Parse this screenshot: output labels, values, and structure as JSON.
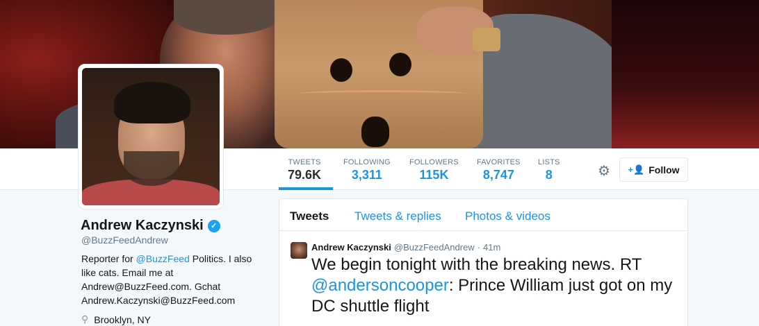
{
  "profile": {
    "name": "Andrew Kaczynski",
    "handle": "@BuzzFeedAndrew",
    "bio_prefix": "Reporter for ",
    "bio_link": "@BuzzFeed",
    "bio_suffix": " Politics. I also like cats. Email me at Andrew@BuzzFeed.com. Gchat Andrew.Kaczynski@BuzzFeed.com",
    "location": "Brooklyn, NY",
    "verified_icon": "verified-check-icon"
  },
  "stats": [
    {
      "label": "TWEETS",
      "value": "79.6K"
    },
    {
      "label": "FOLLOWING",
      "value": "3,311"
    },
    {
      "label": "FOLLOWERS",
      "value": "115K"
    },
    {
      "label": "FAVORITES",
      "value": "8,747"
    },
    {
      "label": "LISTS",
      "value": "8"
    }
  ],
  "actions": {
    "follow_label": "Follow",
    "follow_icon": "add-user-icon",
    "settings_icon": "gear-icon"
  },
  "tabs": [
    {
      "label": "Tweets"
    },
    {
      "label": "Tweets & replies"
    },
    {
      "label": "Photos & videos"
    }
  ],
  "tweet": {
    "author": "Andrew Kaczynski",
    "handle": "@BuzzFeedAndrew",
    "separator": "·",
    "time": "41m",
    "text_prefix": "We begin tonight with the breaking news. RT ",
    "mention": "@andersoncooper",
    "text_suffix": ": Prince William just got on my DC shuttle flight"
  },
  "colors": {
    "accent": "#1b95e0",
    "text": "#14171a",
    "muted": "#657786"
  }
}
